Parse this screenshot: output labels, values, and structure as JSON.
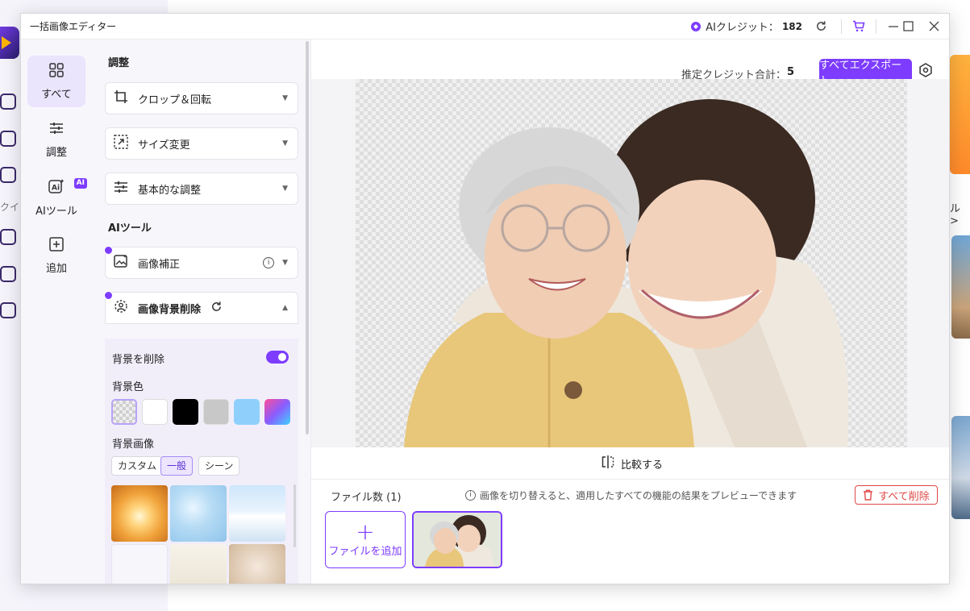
{
  "background_app": {
    "left_text": "クイ",
    "right_text": "ル >"
  },
  "titlebar": {
    "title": "一括画像エディター",
    "credit_label": "AIクレジット：",
    "credit_value": "182",
    "icons": [
      "refresh-icon",
      "cart-icon",
      "maximize-icon",
      "close-icon"
    ]
  },
  "leftnav": {
    "items": [
      {
        "label": "すべて",
        "icon": "grid-icon",
        "active": true
      },
      {
        "label": "調整",
        "icon": "sliders-icon"
      },
      {
        "label": "AIツール",
        "icon": "ai-icon",
        "badge": "AI"
      },
      {
        "label": "追加",
        "icon": "add-box-icon"
      }
    ]
  },
  "toolpanel": {
    "adjust_title": "調整",
    "adjust_tools": [
      {
        "label": "クロップ＆回転",
        "icon": "crop-icon"
      },
      {
        "label": "サイズ変更",
        "icon": "resize-icon"
      },
      {
        "label": "基本的な調整",
        "icon": "sliders-icon"
      }
    ],
    "ai_title": "AIツール",
    "ai_tools": [
      {
        "label": "画像補正",
        "icon": "enhance-icon",
        "info": "i"
      },
      {
        "label": "画像背景削除",
        "icon": "bg-remove-icon",
        "expanded": true
      }
    ],
    "bg_remove": {
      "remove_label": "背景を削除",
      "remove_enabled": true,
      "color_label": "背景色",
      "colors": [
        "transparent",
        "#ffffff",
        "#000000",
        "#c8c8c8",
        "#8ed0fb",
        "gradient"
      ],
      "image_label": "背景画像",
      "tabs": [
        {
          "label": "カスタム",
          "active": false
        },
        {
          "label": "一般",
          "active": true
        },
        {
          "label": "シーン",
          "active": false
        }
      ]
    }
  },
  "main": {
    "est_label": "推定クレジット合計：",
    "est_value": "5",
    "export_label": "すべてエクスポート",
    "compare_label": "比較する",
    "file_count_label": "ファイル数 (1)",
    "hint": "画像を切り替えると、適用したすべての機能の結果をプレビューできます",
    "delete_all_label": "すべて削除",
    "add_file_label": "ファイルを追加"
  },
  "colors": {
    "accent": "#7d3cff",
    "danger": "#e04848"
  }
}
